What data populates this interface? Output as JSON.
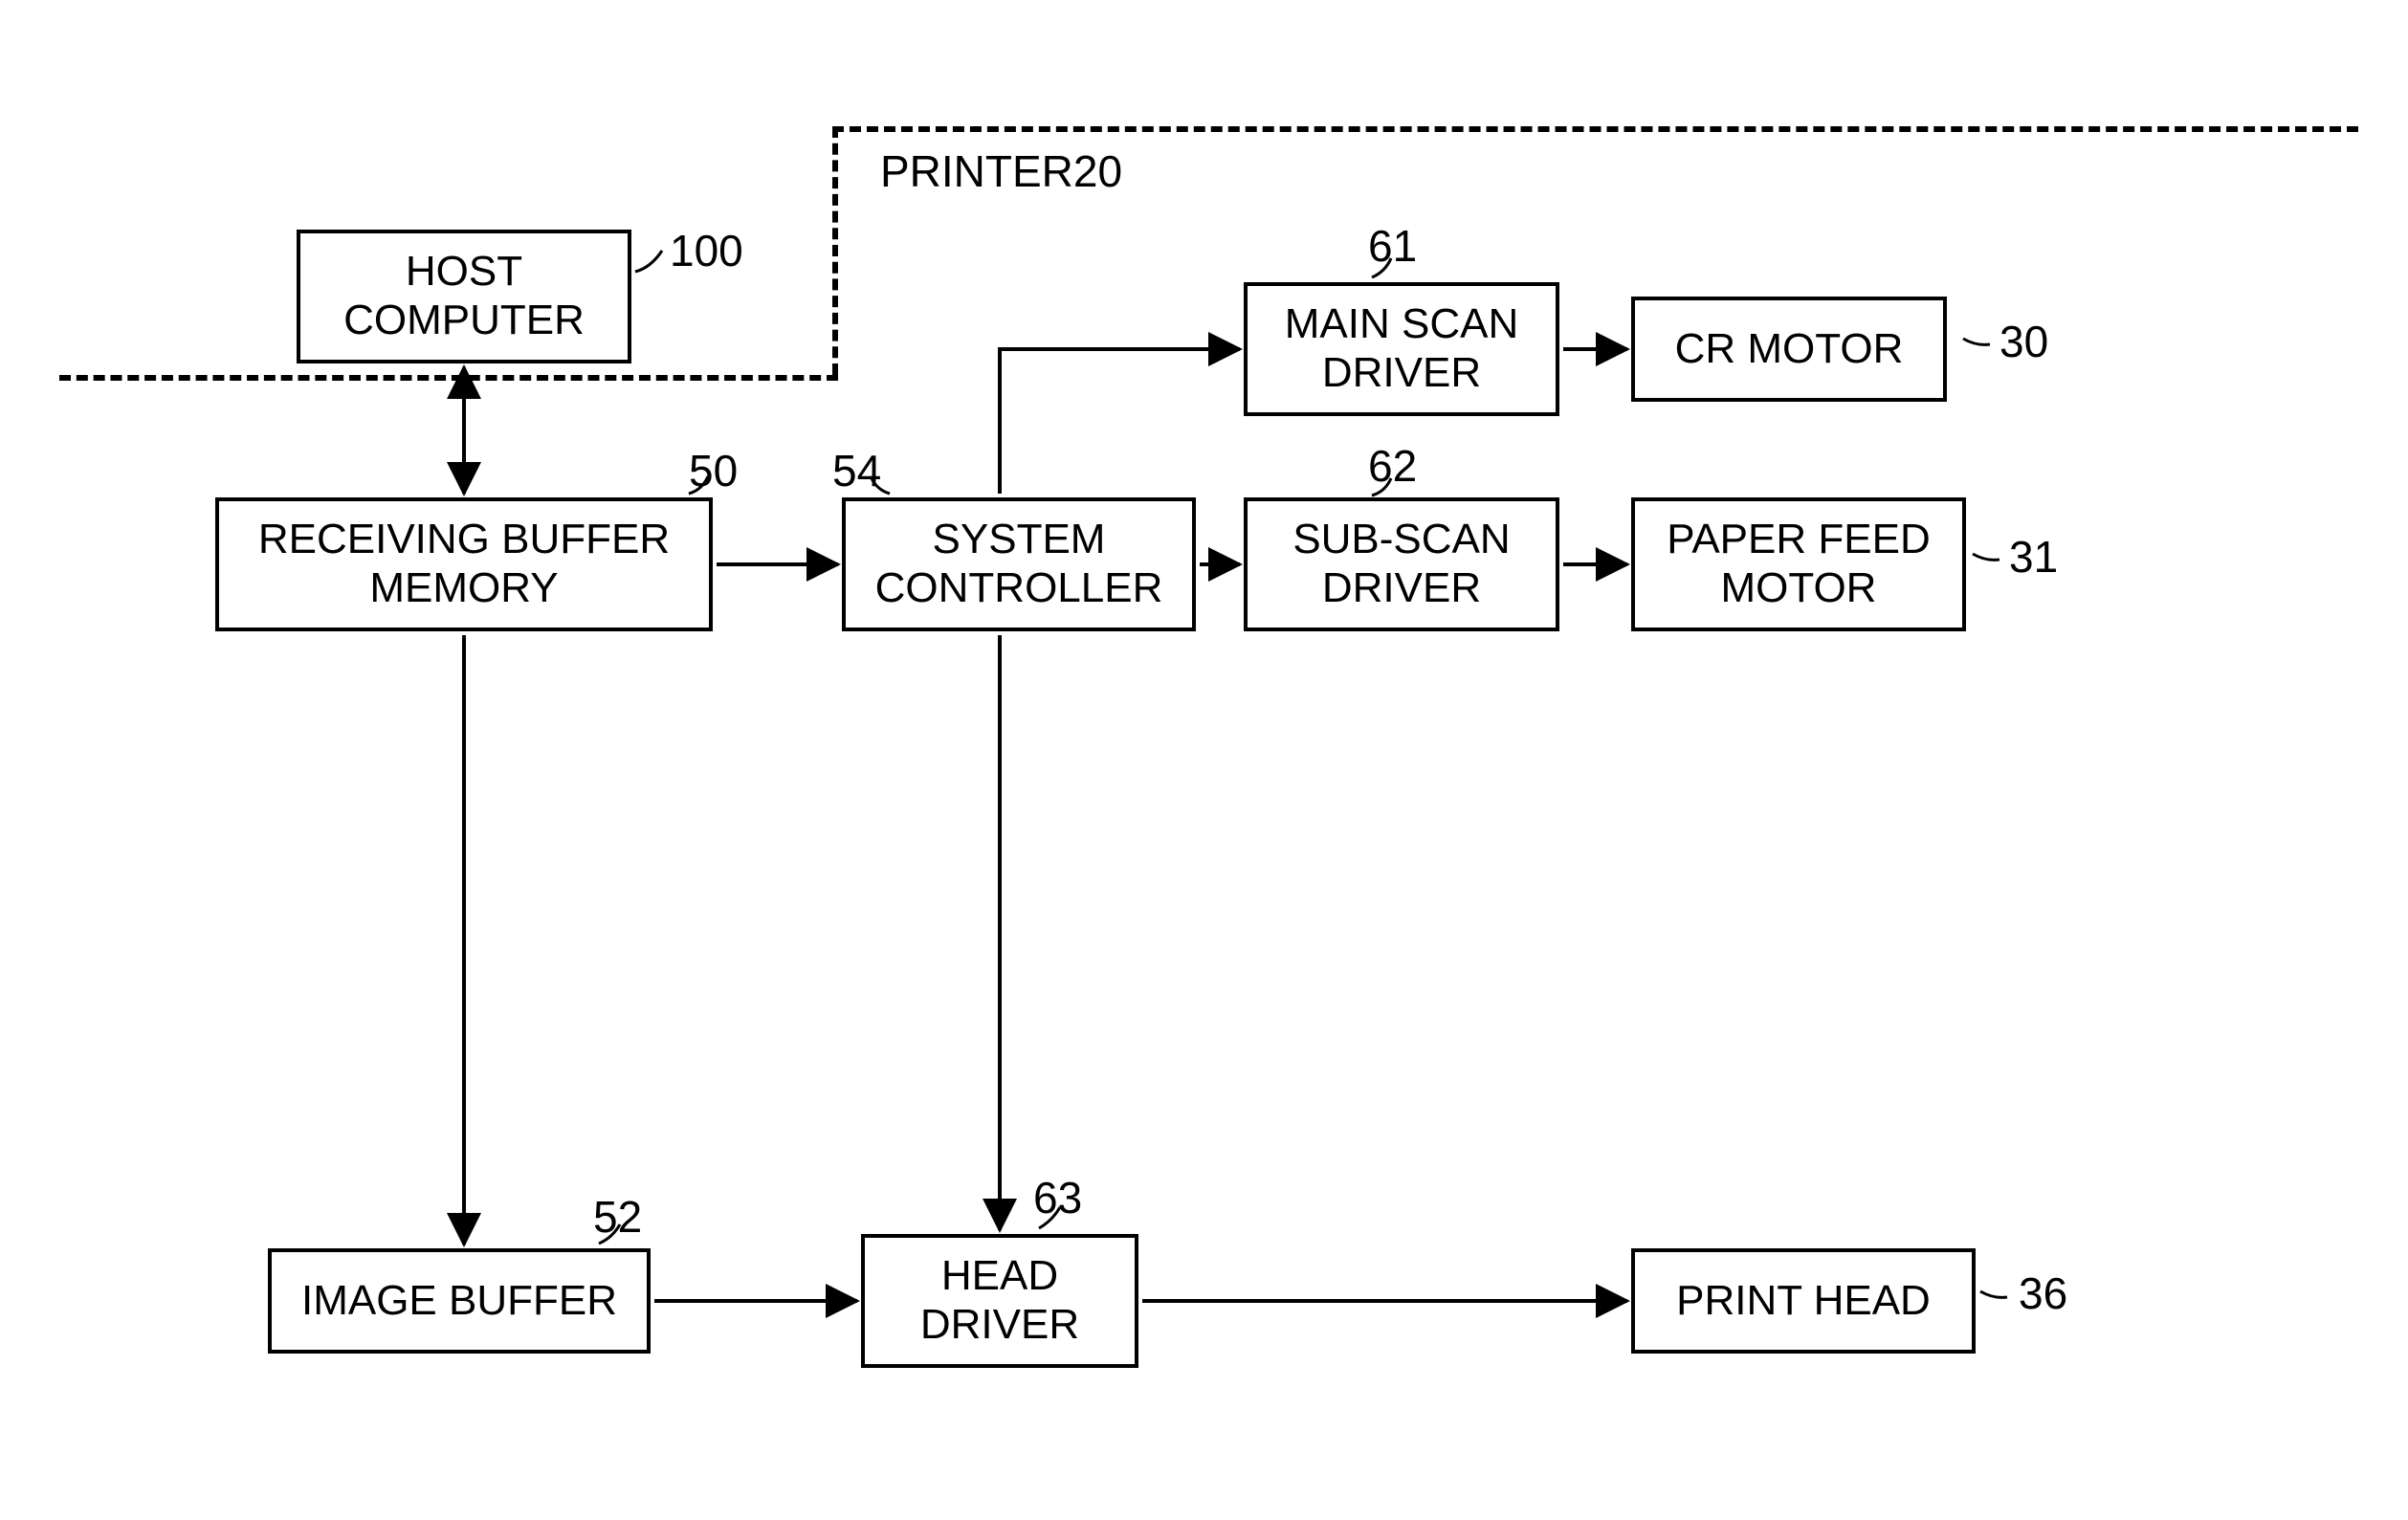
{
  "diagram": {
    "group_label": "PRINTER20",
    "blocks": {
      "host_computer": {
        "label": "HOST\nCOMPUTER",
        "ref": "100"
      },
      "receiving_buffer": {
        "label": "RECEIVING BUFFER\nMEMORY",
        "ref": "50"
      },
      "system_controller": {
        "label": "SYSTEM\nCONTROLLER",
        "ref": "54"
      },
      "main_scan_driver": {
        "label": "MAIN SCAN\nDRIVER",
        "ref": "61"
      },
      "cr_motor": {
        "label": "CR MOTOR",
        "ref": "30"
      },
      "sub_scan_driver": {
        "label": "SUB-SCAN\nDRIVER",
        "ref": "62"
      },
      "paper_feed_motor": {
        "label": "PAPER FEED\nMOTOR",
        "ref": "31"
      },
      "image_buffer": {
        "label": "IMAGE BUFFER",
        "ref": "52"
      },
      "head_driver": {
        "label": "HEAD\nDRIVER",
        "ref": "63"
      },
      "print_head": {
        "label": "PRINT HEAD",
        "ref": "36"
      }
    }
  }
}
